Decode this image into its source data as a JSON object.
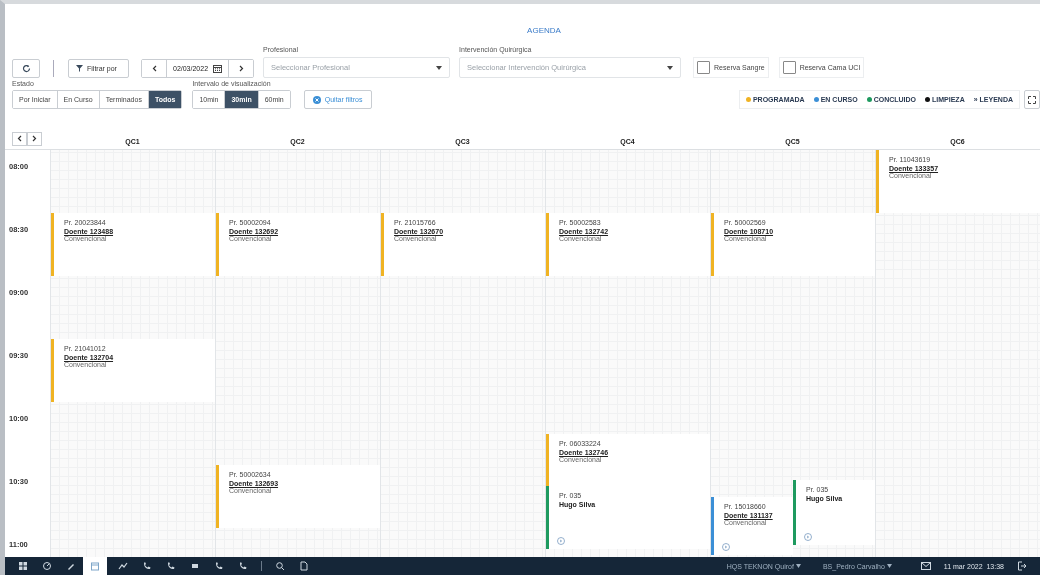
{
  "title": "AGENDA",
  "toolbar": {
    "filter_button": "Filtrar por",
    "date": "02/03/2022",
    "profesional": {
      "label": "Profesional",
      "placeholder": "Seleccionar Profesional"
    },
    "intervencion": {
      "label": "Intervención Quirúrgica",
      "placeholder": "Seleccionar Intervención Quirúrgica"
    },
    "checkboxes": [
      {
        "label": "Reserva Sangre",
        "checked": false
      },
      {
        "label": "Reserva Cama UCI",
        "checked": false
      }
    ]
  },
  "estado": {
    "label": "Estado",
    "options": [
      {
        "label": "Por Iniciar",
        "selected": false
      },
      {
        "label": "En Curso",
        "selected": false
      },
      {
        "label": "Terminados",
        "selected": false
      },
      {
        "label": "Todos",
        "selected": true
      }
    ]
  },
  "intervalo": {
    "label": "Intervalo de visualización",
    "options": [
      {
        "label": "10min",
        "selected": false
      },
      {
        "label": "30min",
        "selected": true
      },
      {
        "label": "60min",
        "selected": false
      }
    ]
  },
  "clear_filters": "Quitar filtros",
  "legend": {
    "items": [
      {
        "label": "PROGRAMADA",
        "color": "#f0b323"
      },
      {
        "label": "EN CURSO",
        "color": "#3b8fd6"
      },
      {
        "label": "CONCLUIDO",
        "color": "#1e9a5f"
      },
      {
        "label": "LIMPIEZA",
        "color": "#111111"
      }
    ],
    "toggle": "»",
    "toggle_label": "LEYENDA"
  },
  "times": [
    "08:00",
    "08:30",
    "09:00",
    "09:30",
    "10:00",
    "10:30",
    "11:00"
  ],
  "rooms": [
    {
      "name": "QC1",
      "events": [
        {
          "color": "#f0b323",
          "pr": "Pr. 20023844",
          "patient": "Doente 123488",
          "type": "Convencional"
        },
        {
          "color": "#f0b323",
          "pr": "Pr. 21041012",
          "patient": "Doente 132704",
          "type": "Convencional"
        }
      ]
    },
    {
      "name": "QC2",
      "events": [
        {
          "color": "#f0b323",
          "pr": "Pr. 50002094",
          "patient": "Doente 132692",
          "type": "Convencional"
        },
        {
          "color": "#f0b323",
          "pr": "Pr. 50002634",
          "patient": "Doente 132693",
          "type": "Convencional"
        }
      ]
    },
    {
      "name": "QC3",
      "events": [
        {
          "color": "#f0b323",
          "pr": "Pr. 21015766",
          "patient": "Doente 132670",
          "type": "Convencional"
        }
      ]
    },
    {
      "name": "QC4",
      "events": [
        {
          "color": "#f0b323",
          "pr": "Pr. 50002583",
          "patient": "Doente 132742",
          "type": "Convencional"
        },
        {
          "color": "#f0b323",
          "pr": "Pr. 06033224",
          "patient": "Doente 132746",
          "type": "Convencional"
        },
        {
          "color": "#1e9a5f",
          "pr": "Pr. 035",
          "name": "Hugo Silva",
          "action": true
        }
      ]
    },
    {
      "name": "QC5",
      "events": [
        {
          "color": "#f0b323",
          "pr": "Pr. 50002569",
          "patient": "Doente 108710",
          "type": "Convencional"
        },
        {
          "color": "#3b8fd6",
          "pr": "Pr. 15018660",
          "patient": "Doente 131137",
          "type": "Convencional",
          "action": true
        },
        {
          "color": "#1e9a5f",
          "pr": "Pr. 035",
          "name": "Hugo Silva",
          "action": true
        }
      ]
    },
    {
      "name": "QC6",
      "events": [
        {
          "color": "#f0b323",
          "pr": "Pr. 11043619",
          "patient": "Doente 133357",
          "type": "Convencional"
        }
      ]
    }
  ],
  "taskbar": {
    "items": [
      {
        "selected": false
      },
      {
        "selected": false
      },
      {
        "selected": false
      },
      {
        "selected": true
      },
      {
        "selected": false
      },
      {
        "selected": false
      },
      {
        "selected": false
      },
      {
        "selected": false
      },
      {
        "selected": false
      },
      {
        "selected": false
      },
      {
        "selected": false
      },
      {
        "selected": false
      }
    ],
    "center": "HQS TEKNON Quirof",
    "user": "BS_Pedro Carvalho",
    "datetime": "11 mar 2022  13:38"
  }
}
